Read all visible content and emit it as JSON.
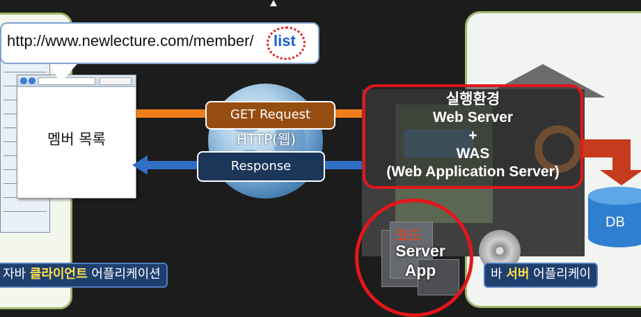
{
  "client": {
    "url_prefix": "http://www.newlecture.com/member/",
    "url_highlight": "list",
    "page_label": "멤버 목록",
    "caption_prefix": "자바 ",
    "caption_highlight": "클라이언트",
    "caption_suffix": " 어플리케이션"
  },
  "network": {
    "protocol_label": "HTTP(웹)",
    "request_label": "GET Request",
    "response_label": "Response"
  },
  "server": {
    "env_title": "실행환경",
    "web_server": "Web Server",
    "plus": "+",
    "was": "WAS",
    "was_full": "(Web Application Server)",
    "code_label": "코드",
    "server_app_line1": "Server",
    "server_app_line2": "App",
    "db_label": "DB",
    "caption_prefix": "바 ",
    "caption_highlight": "서버",
    "caption_suffix": " 어플리케이"
  },
  "colors": {
    "request_arrow": "#ef7d1a",
    "response_arrow": "#2f6fc4",
    "highlight_red": "#e3161b",
    "url_highlight": "#1a5fd6",
    "caption_highlight": "#ffe14a"
  }
}
